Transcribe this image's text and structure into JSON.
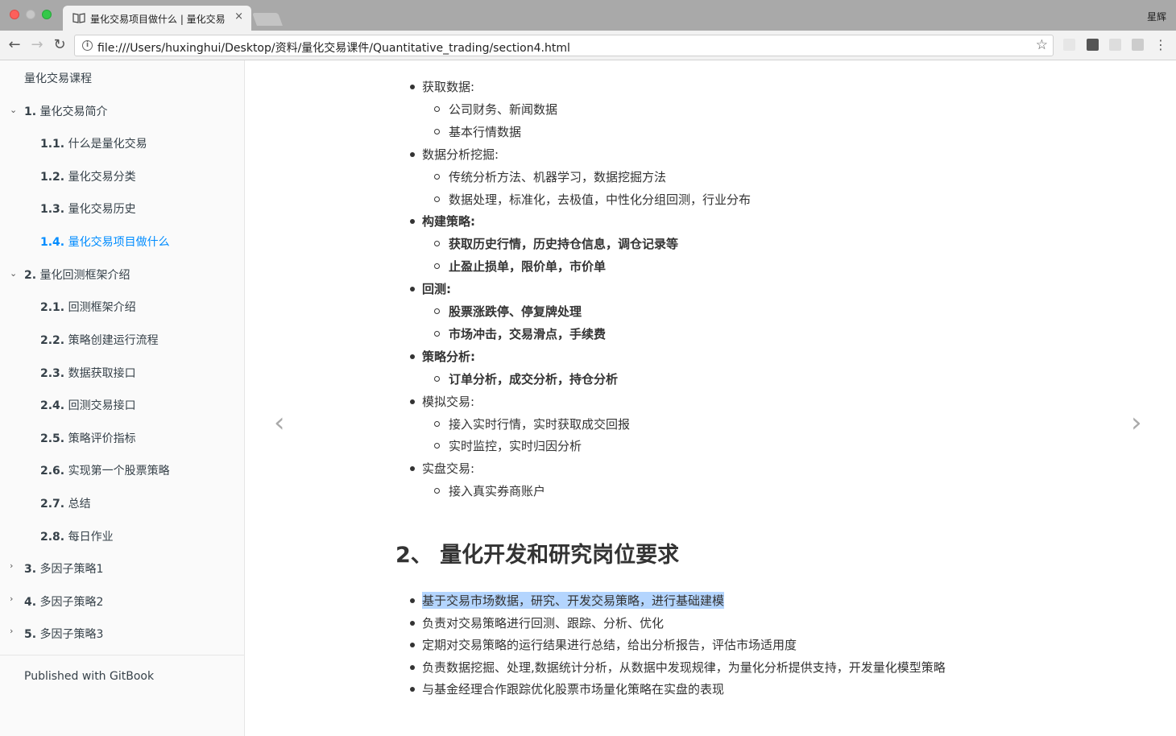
{
  "window": {
    "tab_title": "量化交易项目做什么 | 量化交易",
    "tab_close": "×",
    "user": "星辉"
  },
  "toolbar": {
    "url": "file:///Users/huxinghui/Desktop/资料/量化交易课件/Quantitative_trading/section4.html",
    "back": "←",
    "forward": "→",
    "reload": "↻",
    "star": "☆"
  },
  "sidebar": {
    "title": "量化交易课程",
    "items": [
      {
        "num": "1.",
        "label": "量化交易简介",
        "level": 1,
        "expanded": true
      },
      {
        "num": "1.1.",
        "label": "什么是量化交易",
        "level": 2
      },
      {
        "num": "1.2.",
        "label": "量化交易分类",
        "level": 2
      },
      {
        "num": "1.3.",
        "label": "量化交易历史",
        "level": 2
      },
      {
        "num": "1.4.",
        "label": "量化交易项目做什么",
        "level": 2,
        "active": true
      },
      {
        "num": "2.",
        "label": "量化回测框架介绍",
        "level": 1,
        "expanded": true
      },
      {
        "num": "2.1.",
        "label": "回测框架介绍",
        "level": 2
      },
      {
        "num": "2.2.",
        "label": "策略创建运行流程",
        "level": 2
      },
      {
        "num": "2.3.",
        "label": "数据获取接口",
        "level": 2
      },
      {
        "num": "2.4.",
        "label": "回测交易接口",
        "level": 2
      },
      {
        "num": "2.5.",
        "label": "策略评价指标",
        "level": 2
      },
      {
        "num": "2.6.",
        "label": "实现第一个股票策略",
        "level": 2
      },
      {
        "num": "2.7.",
        "label": "总结",
        "level": 2
      },
      {
        "num": "2.8.",
        "label": "每日作业",
        "level": 2
      },
      {
        "num": "3.",
        "label": "多因子策略1",
        "level": 1,
        "expanded": false
      },
      {
        "num": "4.",
        "label": "多因子策略2",
        "level": 1,
        "expanded": false
      },
      {
        "num": "5.",
        "label": "多因子策略3",
        "level": 1,
        "expanded": false
      }
    ],
    "footer": "Published with GitBook"
  },
  "content": {
    "list1": [
      {
        "text": "获取数据:",
        "level": 1,
        "bold": false
      },
      {
        "text": "公司财务、新闻数据",
        "level": 2,
        "bold": false
      },
      {
        "text": "基本行情数据",
        "level": 2,
        "bold": false
      },
      {
        "text": "数据分析挖掘:",
        "level": 1,
        "bold": false
      },
      {
        "text": "传统分析方法、机器学习，数据挖掘方法",
        "level": 2,
        "bold": false
      },
      {
        "text": "数据处理，标准化，去极值，中性化分组回测，行业分布",
        "level": 2,
        "bold": false
      },
      {
        "text": "构建策略:",
        "level": 1,
        "bold": true
      },
      {
        "text": "获取历史行情，历史持仓信息，调仓记录等",
        "level": 2,
        "bold": true
      },
      {
        "text": "止盈止损单，限价单，市价单",
        "level": 2,
        "bold": true
      },
      {
        "text": "回测:",
        "level": 1,
        "bold": true
      },
      {
        "text": "股票涨跌停、停复牌处理",
        "level": 2,
        "bold": true
      },
      {
        "text": "市场冲击，交易滑点，手续费",
        "level": 2,
        "bold": true
      },
      {
        "text": "策略分析:",
        "level": 1,
        "bold": true
      },
      {
        "text": "订单分析，成交分析，持仓分析",
        "level": 2,
        "bold": true
      },
      {
        "text": "模拟交易:",
        "level": 1,
        "bold": false
      },
      {
        "text": "接入实时行情，实时获取成交回报",
        "level": 2,
        "bold": false
      },
      {
        "text": "实时监控，实时归因分析",
        "level": 2,
        "bold": false
      },
      {
        "text": "实盘交易:",
        "level": 1,
        "bold": false
      },
      {
        "text": "接入真实券商账户",
        "level": 2,
        "bold": false
      }
    ],
    "heading2": "2、 量化开发和研究岗位要求",
    "list2": [
      "基于交易市场数据，研究、开发交易策略，进行基础建模",
      "负责对交易策略进行回测、跟踪、分析、优化",
      "定期对交易策略的运行结果进行总结，给出分析报告，评估市场适用度",
      "负责数据挖掘、处理,数据统计分析，从数据中发现规律，为量化分析提供支持，开发量化模型策略",
      "与基金经理合作跟踪优化股票市场量化策略在实盘的表现"
    ],
    "prev_arrow": "‹",
    "next_arrow": "›"
  },
  "colors": {
    "active_link": "#008cff",
    "selection": "#b4d5fe",
    "sidebar_bg": "#fafafa"
  }
}
